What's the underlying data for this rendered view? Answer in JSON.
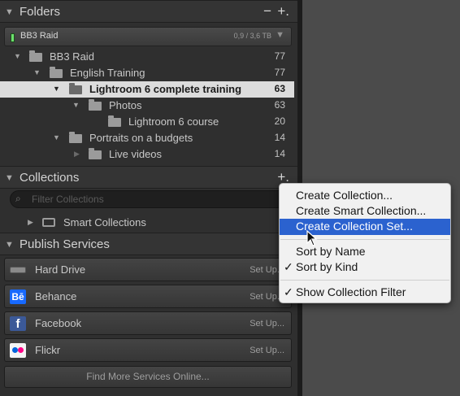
{
  "folders": {
    "title": "Folders",
    "minus": "−",
    "plus": "+.",
    "volume": {
      "name": "BB3 Raid",
      "size": "0,9 / 3,6 TB"
    },
    "rows": [
      {
        "label": "BB3 Raid",
        "count": "77"
      },
      {
        "label": "English Training",
        "count": "77"
      },
      {
        "label": "Lightroom 6 complete training",
        "count": "63"
      },
      {
        "label": "Photos",
        "count": "63"
      },
      {
        "label": "Lightroom 6 course",
        "count": "20"
      },
      {
        "label": "Portraits on a budgets",
        "count": "14"
      },
      {
        "label": "Live videos",
        "count": "14"
      }
    ]
  },
  "collections": {
    "title": "Collections",
    "plus": "+.",
    "filter_placeholder": "Filter Collections",
    "smart_collections": "Smart Collections"
  },
  "publish": {
    "title": "Publish Services",
    "services": [
      {
        "name": "Hard Drive",
        "setup": "Set Up..."
      },
      {
        "name": "Behance",
        "setup": "Set Up...",
        "icon_text": "Bē"
      },
      {
        "name": "Facebook",
        "setup": "Set Up...",
        "icon_text": "f"
      },
      {
        "name": "Flickr",
        "setup": "Set Up..."
      }
    ],
    "find_more": "Find More Services Online..."
  },
  "context_menu": {
    "items": [
      {
        "label": "Create Collection..."
      },
      {
        "label": "Create Smart Collection..."
      },
      {
        "label": "Create Collection Set...",
        "highlighted": true
      },
      {
        "label": "Sort by Name"
      },
      {
        "label": "Sort by Kind",
        "checked": true
      },
      {
        "label": "Show Collection Filter",
        "checked": true
      }
    ],
    "check_mark": "✓"
  },
  "colors": {
    "panel_bg": "#2f2f2f",
    "selected_row": "#dcdcdc",
    "menu_highlight": "#2b62cf",
    "behance_blue": "#1769ff",
    "facebook_blue": "#3b5998",
    "flickr_pink": "#ff0084",
    "flickr_blue": "#0063dc"
  }
}
